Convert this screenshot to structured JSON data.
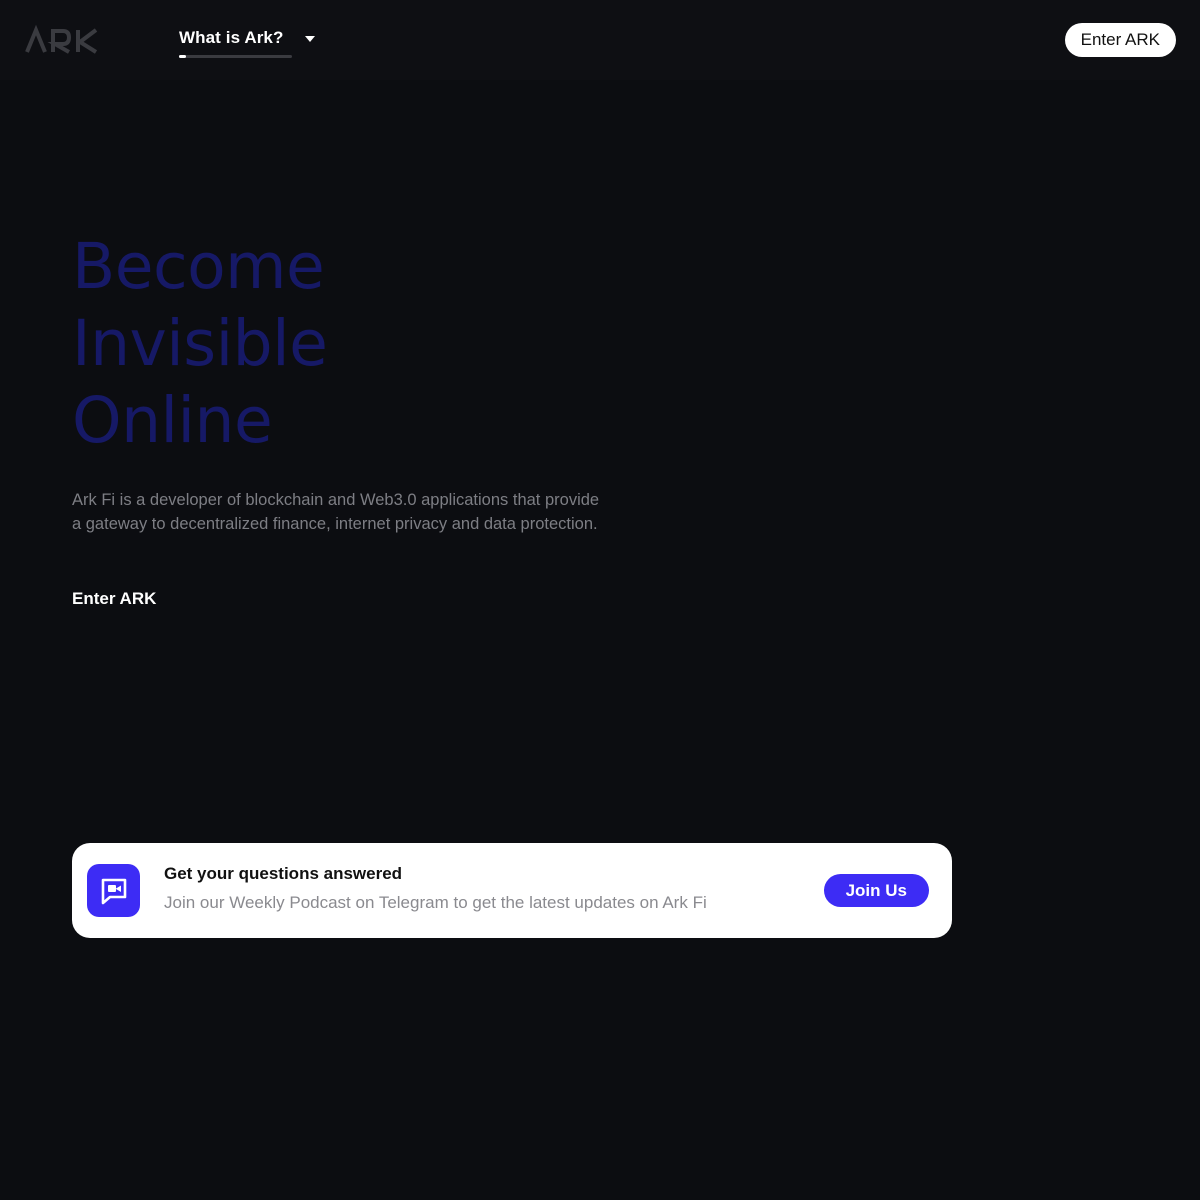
{
  "colors": {
    "page_background": "#0c0d11",
    "header_background": "#0e0f13",
    "hero_title": "#161966",
    "accent": "#3d2cf5",
    "muted_text": "#7d7e84"
  },
  "header": {
    "logo_text": "ARK",
    "logo_icon": "ark-logo",
    "nav_label": "What is Ark?",
    "nav_caret_icon": "caret-down-icon",
    "enter_button_label": "Enter ARK"
  },
  "hero": {
    "title_lines": [
      "Become",
      "Invisible",
      "Online"
    ],
    "description": "Ark Fi is a developer of blockchain and Web3.0 applications that provide a gateway to decentralized finance, internet privacy and data protection.",
    "cta_label": "Enter ARK"
  },
  "podcast_card": {
    "icon": "video-chat-icon",
    "title": "Get your questions answered",
    "subtitle": "Join our Weekly Podcast on Telegram to get the latest updates on Ark Fi",
    "button_label": "Join Us"
  }
}
